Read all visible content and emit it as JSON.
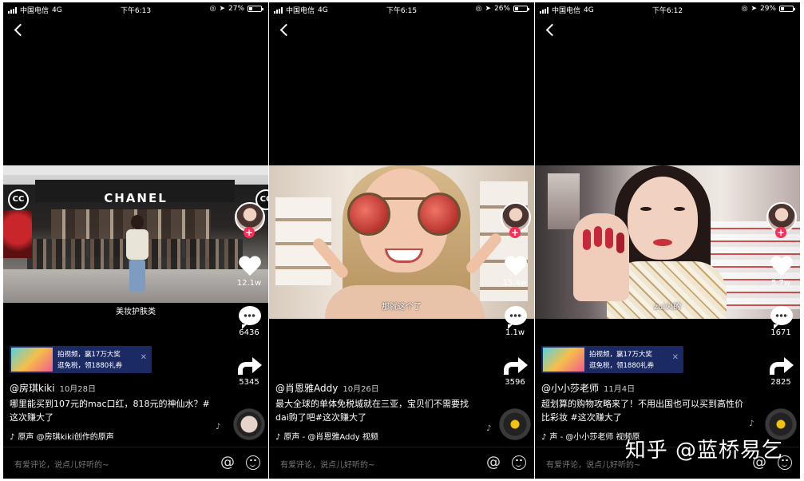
{
  "screens": [
    {
      "status": {
        "carrier": "中国电信",
        "network": "4G",
        "time": "下午6:13",
        "battery": "27%",
        "battery_level": 0.27
      },
      "caption": "美妆护肤类",
      "likes": "12.1w",
      "comments": "6436",
      "shares": "5345",
      "ad": {
        "line1": "拍视频，赢17万大奖",
        "line2": "逛免税，领1880礼券"
      },
      "author": "@房琪kiki",
      "date": "10月28日",
      "desc": "哪里能买到107元的mac口红，818元的神仙水？#这次赚大了",
      "music": "原声    @房琪kiki创作的原声",
      "video": {
        "overlay_text": "CHANEL",
        "logo_text": "CC"
      }
    },
    {
      "status": {
        "carrier": "中国电信",
        "network": "4G",
        "time": "下午6:15",
        "battery": "26%",
        "battery_level": 0.26
      },
      "caption": "那就这个了",
      "likes": "15.4w",
      "comments": "1.1w",
      "shares": "3596",
      "author": "@肖恩雅Addy",
      "date": "10月26日",
      "desc": "最大全球的单体免税城就在三亚，宝贝们不需要找dai购了吧#这次赚大了",
      "music": "原声 - @肖恩雅Addy    视频"
    },
    {
      "status": {
        "carrier": "中国电信",
        "network": "4G",
        "time": "下午6:12",
        "battery": "29%",
        "battery_level": 0.29
      },
      "caption": "zui火的",
      "likes": "5.7w",
      "comments": "1671",
      "shares": "2825",
      "ad": {
        "line1": "拍视频，赢17万大奖",
        "line2": "逛免税，领1880礼券"
      },
      "author": "@小小莎老师",
      "date": "11月4日",
      "desc": "超划算的购物攻略来了！不用出国也可以买到高性价比彩妆 #这次赚大了",
      "music": "声 - @小小莎老师    视频原"
    }
  ],
  "comment_placeholder": "有爱评论，说点儿好听的~",
  "watermark": "知乎 @蓝桥易乞",
  "colors": {
    "follow_plus": "#fe2c55",
    "ad_bg": "#1c2a63"
  }
}
